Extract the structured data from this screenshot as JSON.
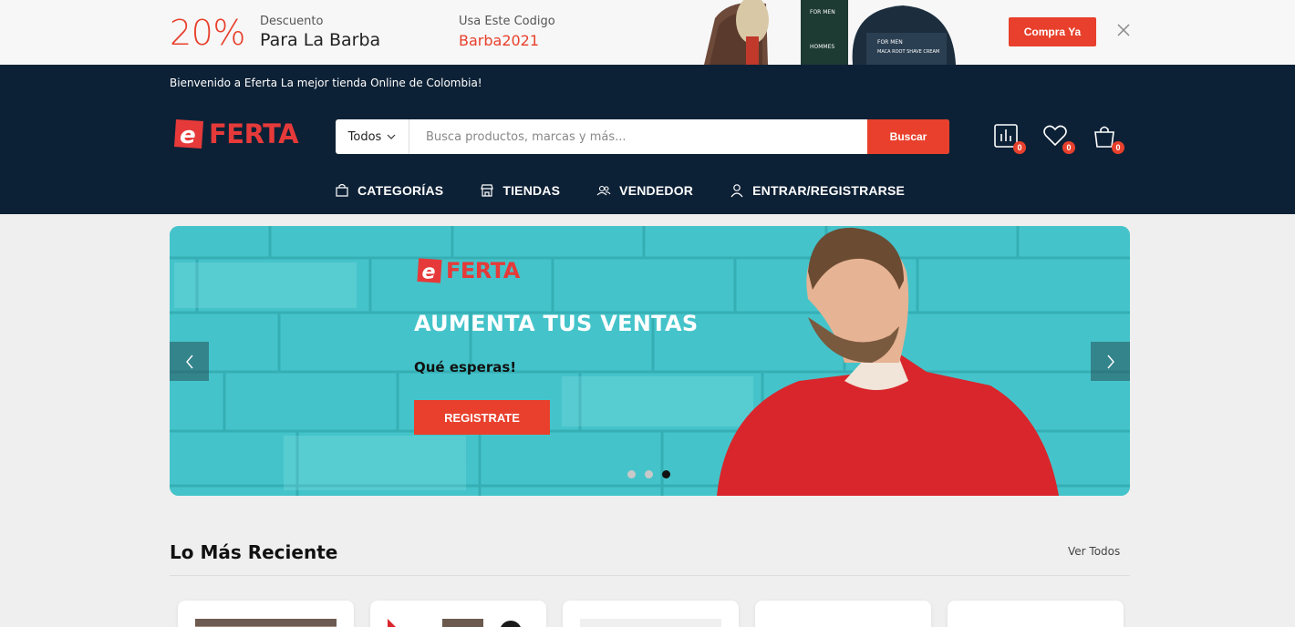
{
  "promo": {
    "percent": "20%",
    "discount_label": "Descuento",
    "discount_title": "Para La Barba",
    "code_label": "Usa Este Codigo",
    "code_value": "Barba2021",
    "buy_button": "Compra Ya",
    "product_art": [
      "FOR MEN",
      "HOMMES",
      "FOR MEN",
      "MACA ROOT SHAVE CREAM"
    ]
  },
  "header": {
    "welcome": "Bienvenido a Eferta La mejor tienda Online de Colombia!",
    "logo_text": "FERTA",
    "search": {
      "category": "Todos",
      "placeholder": "Busca productos, marcas y más...",
      "button": "Buscar"
    },
    "counters": {
      "compare": "0",
      "wishlist": "0",
      "cart": "0"
    },
    "nav": [
      {
        "label": "CATEGORÍAS",
        "icon": "bag-icon"
      },
      {
        "label": "TIENDAS",
        "icon": "store-icon"
      },
      {
        "label": "VENDEDOR",
        "icon": "users-icon"
      },
      {
        "label": "ENTRAR/REGISTRARSE",
        "icon": "user-icon"
      }
    ]
  },
  "hero": {
    "logo_text": "FERTA",
    "title": "AUMENTA TUS VENTAS",
    "subtitle": "Qué esperas!",
    "button": "REGISTRATE",
    "slides_count": 3,
    "active_slide": 3
  },
  "section": {
    "title": "Lo Más Reciente",
    "link": "Ver Todos"
  },
  "colors": {
    "accent": "#e8402c",
    "header_bg": "#0d2136",
    "hero_bg": "#43c6cc"
  }
}
